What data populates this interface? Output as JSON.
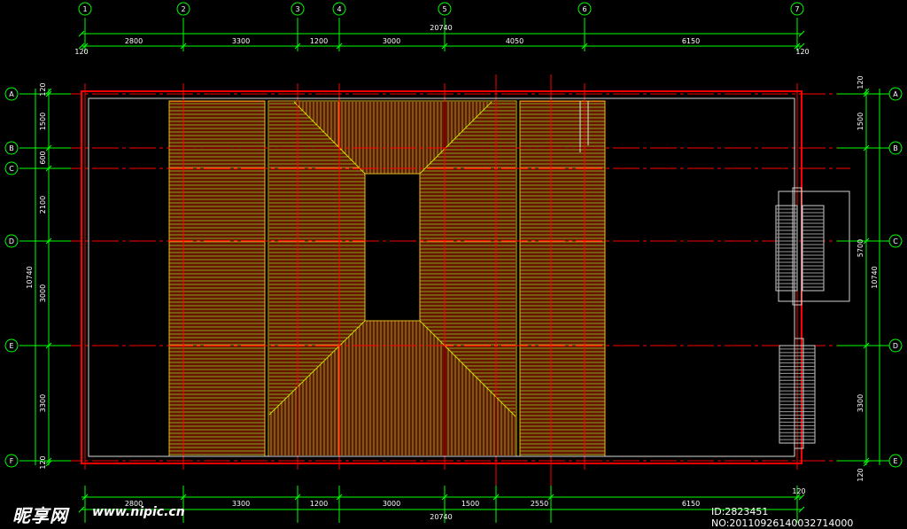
{
  "drawing": {
    "top_axis_labels": [
      "1",
      "2",
      "3",
      "4",
      "5",
      "6",
      "7"
    ],
    "left_axis_labels": [
      "A",
      "B",
      "C",
      "D",
      "E",
      "F"
    ],
    "right_axis_labels": [
      "A",
      "B",
      "C",
      "D",
      "E"
    ],
    "top_overall": "20740",
    "top_edge_left": "120",
    "top_edge_right": "120",
    "top_spans": [
      "2800",
      "3300",
      "1200",
      "3000",
      "4050",
      "6150"
    ],
    "bottom_overall": "20740",
    "bottom_edge_right": "120",
    "bottom_spans": [
      "2800",
      "3300",
      "1200",
      "3000",
      "1500",
      "2550",
      "6150"
    ],
    "left_overall": "10740",
    "left_edge_top": "120",
    "left_edge_bottom": "120",
    "left_spans": [
      "1500",
      "600",
      "2100",
      "3000",
      "3300"
    ],
    "right_overall": "10740",
    "right_edge_top": "120",
    "right_edge_bottom": "120",
    "right_spans": [
      "1500",
      "5700",
      "3300"
    ]
  },
  "colors": {
    "background": "#000000",
    "dimension": "#00ff00",
    "axis_line": "#ff0000",
    "wall": "#d8d8d8",
    "roof_hatch_red": "#d42a00",
    "roof_hatch_yellow": "#e8b820"
  },
  "watermark": {
    "brand": "昵享网",
    "site": "www.nipic.cn",
    "id_text": "ID:2823451 NO:20110926140032714000"
  }
}
